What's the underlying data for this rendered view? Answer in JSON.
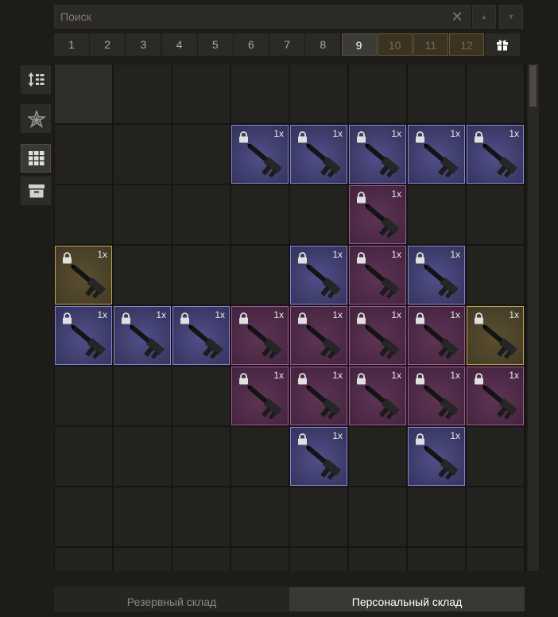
{
  "search": {
    "placeholder": "Поиск",
    "value": ""
  },
  "icons": {
    "clear": "close-icon",
    "up": "arrow-up-icon",
    "down": "arrow-down-icon",
    "gift": "gift-icon"
  },
  "pages": [
    "1",
    "2",
    "3",
    "4",
    "5",
    "6",
    "7",
    "8",
    "9",
    "10",
    "11",
    "12"
  ],
  "active_page": "9",
  "gold_pages": [
    "10",
    "11",
    "12"
  ],
  "tools": [
    {
      "name": "sort-tool",
      "icon": "sort-icon"
    },
    {
      "name": "favorites-tool",
      "icon": "star-icon"
    },
    {
      "name": "grid-view-tool",
      "icon": "grid-icon",
      "active": true
    },
    {
      "name": "storage-tool",
      "icon": "box-icon"
    }
  ],
  "grid": {
    "columns": 8,
    "rows": 9
  },
  "items": [
    {
      "row": 1,
      "col": 3,
      "rarity": "blue",
      "qty": "1x"
    },
    {
      "row": 1,
      "col": 4,
      "rarity": "blue",
      "qty": "1x"
    },
    {
      "row": 1,
      "col": 5,
      "rarity": "blue",
      "qty": "1x"
    },
    {
      "row": 1,
      "col": 6,
      "rarity": "blue",
      "qty": "1x"
    },
    {
      "row": 1,
      "col": 7,
      "rarity": "blue",
      "qty": "1x"
    },
    {
      "row": 2,
      "col": 5,
      "rarity": "pink",
      "qty": "1x"
    },
    {
      "row": 3,
      "col": 0,
      "rarity": "gold",
      "qty": "1x"
    },
    {
      "row": 3,
      "col": 4,
      "rarity": "blue",
      "qty": "1x"
    },
    {
      "row": 3,
      "col": 5,
      "rarity": "pink",
      "qty": "1x"
    },
    {
      "row": 3,
      "col": 6,
      "rarity": "blue",
      "qty": "1x"
    },
    {
      "row": 4,
      "col": 0,
      "rarity": "blue",
      "qty": "1x"
    },
    {
      "row": 4,
      "col": 1,
      "rarity": "blue",
      "qty": "1x"
    },
    {
      "row": 4,
      "col": 2,
      "rarity": "blue",
      "qty": "1x"
    },
    {
      "row": 4,
      "col": 3,
      "rarity": "pink",
      "qty": "1x"
    },
    {
      "row": 4,
      "col": 4,
      "rarity": "pink",
      "qty": "1x"
    },
    {
      "row": 4,
      "col": 5,
      "rarity": "pink",
      "qty": "1x"
    },
    {
      "row": 4,
      "col": 6,
      "rarity": "pink",
      "qty": "1x"
    },
    {
      "row": 4,
      "col": 7,
      "rarity": "gold",
      "qty": "1x"
    },
    {
      "row": 5,
      "col": 3,
      "rarity": "pink",
      "qty": "1x"
    },
    {
      "row": 5,
      "col": 4,
      "rarity": "pink",
      "qty": "1x"
    },
    {
      "row": 5,
      "col": 5,
      "rarity": "pink",
      "qty": "1x"
    },
    {
      "row": 5,
      "col": 6,
      "rarity": "pink",
      "qty": "1x"
    },
    {
      "row": 5,
      "col": 7,
      "rarity": "pink",
      "qty": "1x"
    },
    {
      "row": 6,
      "col": 4,
      "rarity": "blue",
      "qty": "1x"
    },
    {
      "row": 6,
      "col": 6,
      "rarity": "blue",
      "qty": "1x"
    }
  ],
  "bottom_tabs": {
    "reserve": "Резервный склад",
    "personal": "Персональный склад",
    "active": "personal"
  },
  "colors": {
    "blue": "#8386d8",
    "pink": "#a05a95",
    "gold": "#c2a44e",
    "background": "#1e1c19"
  }
}
